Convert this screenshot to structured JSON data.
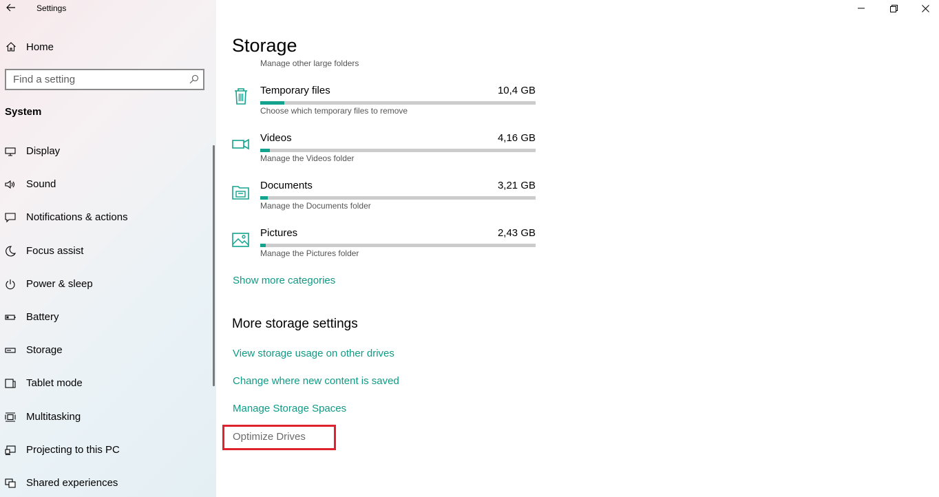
{
  "window": {
    "title": "Settings",
    "controls": {
      "minimize": "minimize-icon",
      "restore": "restore-icon",
      "close": "close-icon"
    }
  },
  "sidebar": {
    "home_label": "Home",
    "search_placeholder": "Find a setting",
    "section": "System",
    "items": [
      {
        "label": "Display",
        "icon": "display-icon"
      },
      {
        "label": "Sound",
        "icon": "sound-icon"
      },
      {
        "label": "Notifications & actions",
        "icon": "notifications-icon"
      },
      {
        "label": "Focus assist",
        "icon": "moon-icon"
      },
      {
        "label": "Power & sleep",
        "icon": "power-icon"
      },
      {
        "label": "Battery",
        "icon": "battery-icon"
      },
      {
        "label": "Storage",
        "icon": "storage-icon"
      },
      {
        "label": "Tablet mode",
        "icon": "tablet-icon"
      },
      {
        "label": "Multitasking",
        "icon": "multitasking-icon"
      },
      {
        "label": "Projecting to this PC",
        "icon": "projecting-icon"
      },
      {
        "label": "Shared experiences",
        "icon": "shared-icon"
      }
    ]
  },
  "main": {
    "title": "Storage",
    "cut_description": "Manage other large folders",
    "categories": [
      {
        "name": "Temporary files",
        "size": "10,4 GB",
        "desc": "Choose which temporary files to remove",
        "fill": 0.088,
        "icon": "trash-icon"
      },
      {
        "name": "Videos",
        "size": "4,16 GB",
        "desc": "Manage the Videos folder",
        "fill": 0.035,
        "icon": "video-camera-icon"
      },
      {
        "name": "Documents",
        "size": "3,21 GB",
        "desc": "Manage the Documents folder",
        "fill": 0.027,
        "icon": "documents-icon"
      },
      {
        "name": "Pictures",
        "size": "2,43 GB",
        "desc": "Manage the Pictures folder",
        "fill": 0.02,
        "icon": "pictures-icon"
      }
    ],
    "show_more": "Show more categories",
    "more_heading": "More storage settings",
    "links": [
      "View storage usage on other drives",
      "Change where new content is saved",
      "Manage Storage Spaces",
      "Optimize Drives"
    ]
  },
  "colors": {
    "accent": "#13a38e",
    "link": "#0f9a85",
    "highlight": "#e0212e"
  }
}
